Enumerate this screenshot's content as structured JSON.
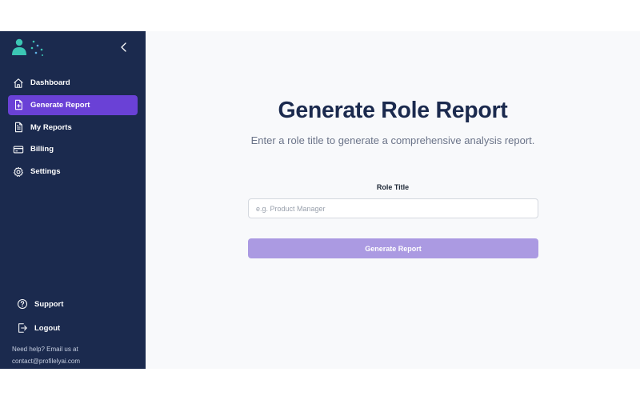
{
  "sidebar": {
    "items": [
      {
        "label": "Dashboard",
        "icon": "home-icon"
      },
      {
        "label": "Generate Report",
        "icon": "file-plus-icon",
        "active": true
      },
      {
        "label": "My Reports",
        "icon": "file-text-icon"
      },
      {
        "label": "Billing",
        "icon": "credit-card-icon"
      },
      {
        "label": "Settings",
        "icon": "gear-icon"
      }
    ],
    "support_label": "Support",
    "logout_label": "Logout",
    "help_line1": "Need help? Email us at",
    "help_line2": "contact@profilelyai.com"
  },
  "main": {
    "title": "Generate Role Report",
    "subtitle": "Enter a role title to generate a comprehensive analysis report.",
    "field_label": "Role Title",
    "field_placeholder": "e.g. Product Manager",
    "field_value": "",
    "button_label": "Generate Report"
  },
  "colors": {
    "sidebar_bg": "#1b2a4e",
    "active_item": "#6a41d6",
    "button": "#ab9ae2",
    "logo_teal": "#3cc6b4",
    "main_bg": "#f8f9fb"
  }
}
